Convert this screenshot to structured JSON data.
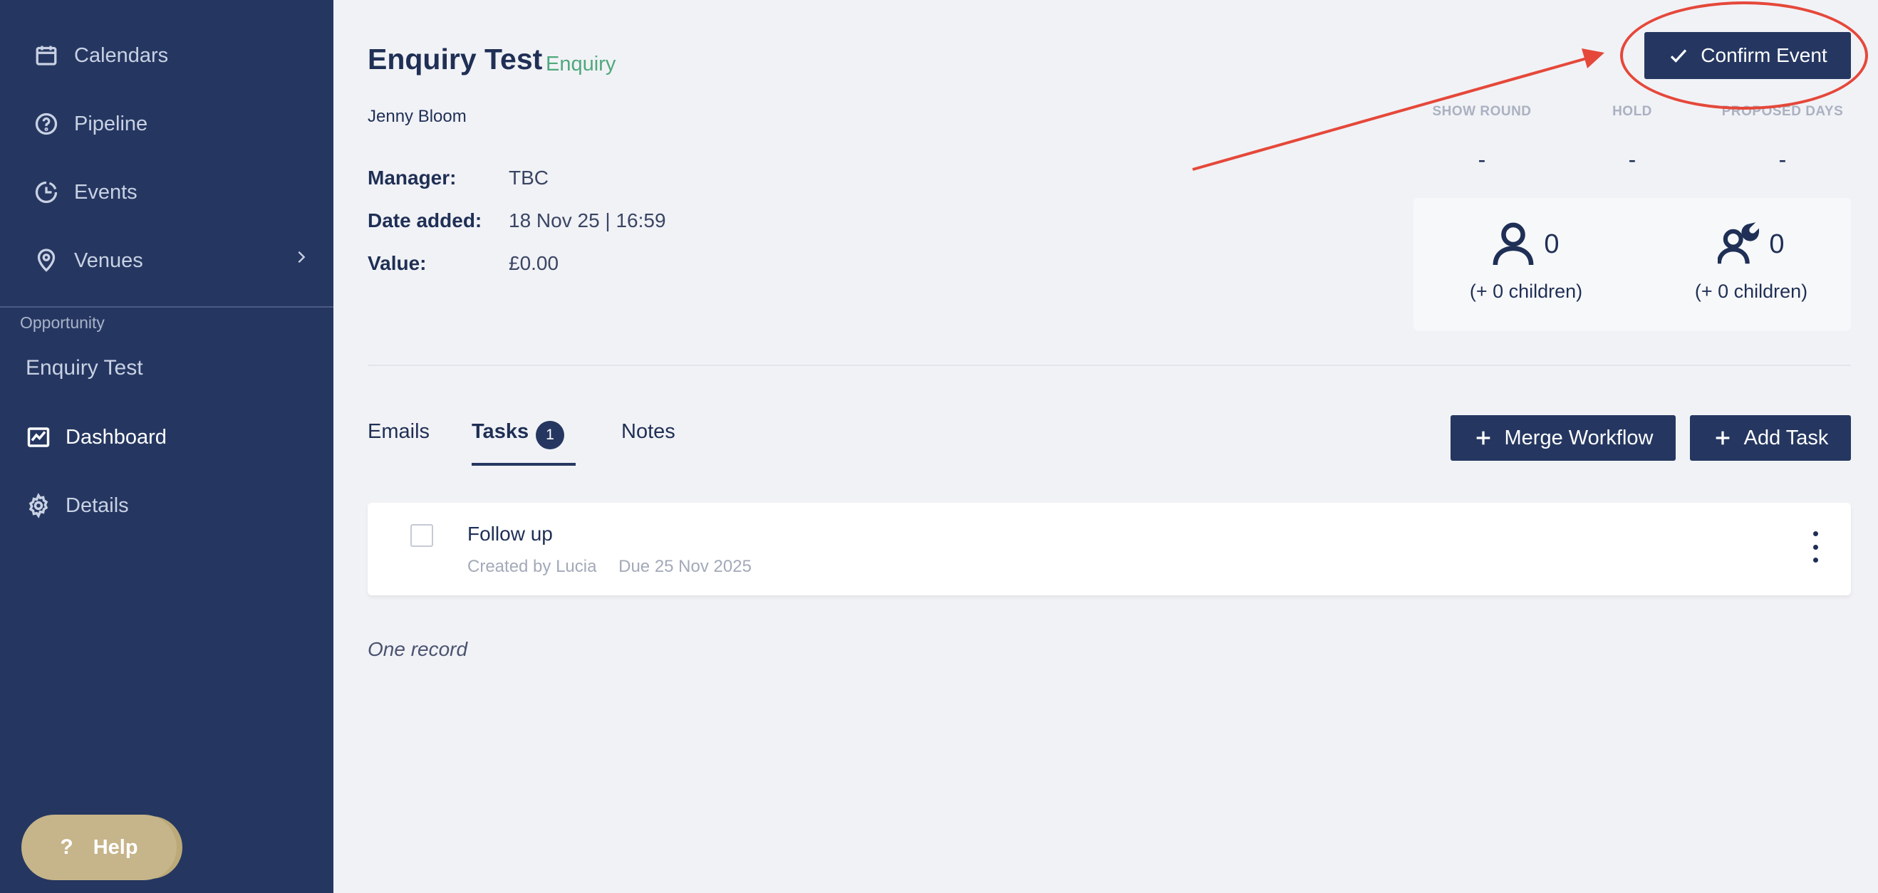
{
  "sidebar": {
    "nav": [
      {
        "label": "Calendars",
        "icon": "calendar-icon"
      },
      {
        "label": "Pipeline",
        "icon": "question-circle-icon"
      },
      {
        "label": "Events",
        "icon": "clock-pie-icon"
      },
      {
        "label": "Venues",
        "icon": "location-pin-icon"
      }
    ],
    "section_label": "Opportunity",
    "opportunity_name": "Enquiry Test",
    "sub_nav": [
      {
        "label": "Dashboard",
        "icon": "chart-line-icon",
        "active": true
      },
      {
        "label": "Details",
        "icon": "gear-icon",
        "active": false
      }
    ],
    "help_label": "Help",
    "help_glyph": "?"
  },
  "header": {
    "title": "Enquiry Test",
    "type_badge": "Enquiry",
    "contact": "Jenny Bloom",
    "confirm_label": "Confirm Event"
  },
  "meta": [
    {
      "label": "Manager:",
      "value": "TBC"
    },
    {
      "label": "Date added:",
      "value": "18 Nov 25 | 16:59"
    },
    {
      "label": "Value:",
      "value": "£0.00"
    }
  ],
  "stats": [
    {
      "label": "SHOW ROUND",
      "value": "-"
    },
    {
      "label": "HOLD",
      "value": "-"
    },
    {
      "label": "PROPOSED DAYS",
      "value": "-"
    }
  ],
  "guests": [
    {
      "count": "0",
      "children": "(+ 0 children)",
      "icon": "person-icon"
    },
    {
      "count": "0",
      "children": "(+ 0 children)",
      "icon": "person-night-icon"
    }
  ],
  "tabs": [
    {
      "label": "Emails"
    },
    {
      "label": "Tasks",
      "count": "1",
      "active": true
    },
    {
      "label": "Notes"
    }
  ],
  "actions": {
    "merge_workflow": "Merge Workflow",
    "add_task": "Add Task"
  },
  "tasks": [
    {
      "title": "Follow up",
      "created_by": "Created by Lucia",
      "due": "Due 25 Nov 2025"
    }
  ],
  "record_count": "One record",
  "colors": {
    "sidebar": "#253761",
    "accent": "#253761",
    "enquiry_badge": "#4fa97d",
    "annotation": "#e5483a",
    "help_button": "#c6b48a"
  }
}
